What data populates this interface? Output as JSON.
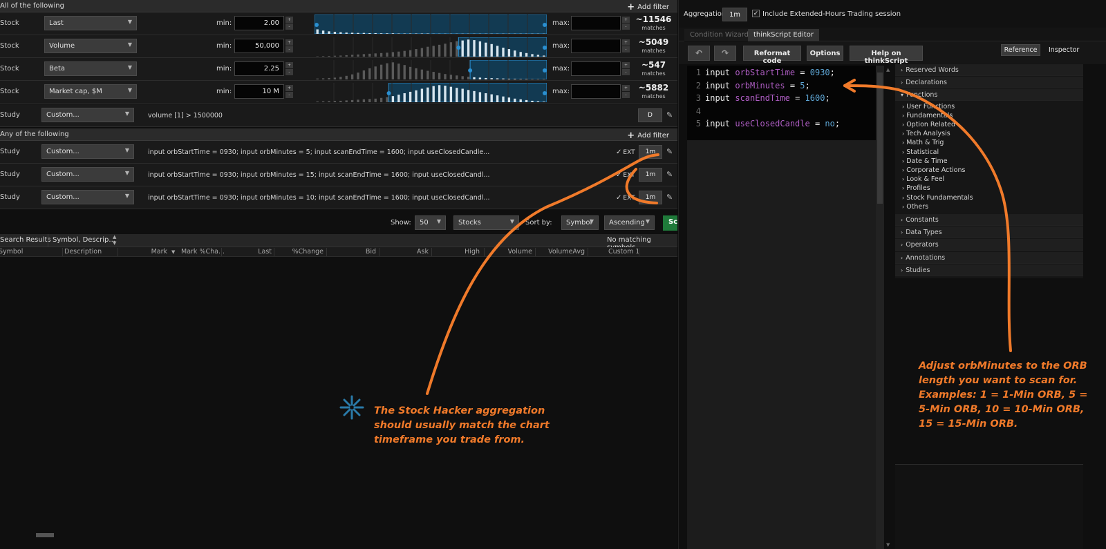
{
  "left": {
    "all_group": {
      "title": "All of the following",
      "add_filter": "Add filter"
    },
    "any_group": {
      "title": "Any of the following",
      "add_filter": "Add filter"
    },
    "filters": [
      {
        "kind": "Stock",
        "field": "Last",
        "min_label": "min:",
        "min": "2.00",
        "max_label": "max:",
        "max": "",
        "count": "~11546",
        "matches": "matches",
        "hist": [
          0.25,
          0.18,
          0.14,
          0.11,
          0.09,
          0.07,
          0.06,
          0.05,
          0.05,
          0.04,
          0.04,
          0.03,
          0.03,
          0.03,
          0.02,
          0.02,
          0.02,
          0.02,
          0.02,
          0.02,
          0.01,
          0.01,
          0.01,
          0.01,
          0.01,
          0.01,
          0.01,
          0.01,
          0.01,
          0.01,
          0.01,
          0.01,
          0.01,
          0.01,
          0.01,
          0.01,
          0.01,
          0.01,
          0.01,
          0.01
        ],
        "range": [
          0.0,
          1.0
        ]
      },
      {
        "kind": "Stock",
        "field": "Volume",
        "min_label": "min:",
        "min": "50,000",
        "max_label": "max:",
        "max": "",
        "count": "~5049",
        "matches": "matches",
        "hist": [
          0.02,
          0.03,
          0.04,
          0.05,
          0.06,
          0.08,
          0.1,
          0.12,
          0.14,
          0.16,
          0.18,
          0.2,
          0.22,
          0.25,
          0.28,
          0.32,
          0.36,
          0.42,
          0.48,
          0.55,
          0.6,
          0.66,
          0.72,
          0.8,
          0.86,
          0.9,
          0.95,
          0.92,
          0.85,
          0.78,
          0.7,
          0.6,
          0.5,
          0.42,
          0.34,
          0.26,
          0.2,
          0.14,
          0.1,
          0.06
        ],
        "range": [
          0.62,
          1.0
        ]
      },
      {
        "kind": "Stock",
        "field": "Beta",
        "min_label": "min:",
        "min": "2.25",
        "max_label": "max:",
        "max": "",
        "count": "~547",
        "matches": "matches",
        "hist": [
          0.05,
          0.06,
          0.08,
          0.1,
          0.14,
          0.2,
          0.28,
          0.38,
          0.5,
          0.62,
          0.72,
          0.82,
          0.9,
          0.95,
          0.88,
          0.8,
          0.7,
          0.62,
          0.55,
          0.48,
          0.42,
          0.36,
          0.3,
          0.26,
          0.22,
          0.18,
          0.15,
          0.12,
          0.1,
          0.08,
          0.07,
          0.06,
          0.05,
          0.04,
          0.04,
          0.03,
          0.03,
          0.02,
          0.02,
          0.02
        ],
        "range": [
          0.67,
          1.0
        ]
      },
      {
        "kind": "Stock",
        "field": "Market cap, $M",
        "min_label": "min:",
        "min": "10 M",
        "max_label": "max:",
        "max": "",
        "count": "~5882",
        "matches": "matches",
        "hist": [
          0.04,
          0.05,
          0.06,
          0.07,
          0.08,
          0.1,
          0.12,
          0.14,
          0.16,
          0.18,
          0.2,
          0.24,
          0.28,
          0.34,
          0.42,
          0.5,
          0.58,
          0.66,
          0.75,
          0.82,
          0.9,
          0.95,
          0.92,
          0.86,
          0.8,
          0.75,
          0.68,
          0.62,
          0.56,
          0.5,
          0.44,
          0.38,
          0.32,
          0.26,
          0.2,
          0.16,
          0.12,
          0.08,
          0.05,
          0.03
        ],
        "range": [
          0.32,
          1.0
        ]
      }
    ],
    "study_all": {
      "kind": "Study",
      "field": "Custom...",
      "condition": "volume [1] > 1500000",
      "agg": "D"
    },
    "study_any": [
      {
        "kind": "Study",
        "field": "Custom...",
        "condition": "input orbStartTime = 0930; input orbMinutes = 5; input scanEndTime = 1600;  input useClosedCandle...",
        "ext": "EXT",
        "agg": "1m"
      },
      {
        "kind": "Study",
        "field": "Custom...",
        "condition": "input orbStartTime = 0930; input orbMinutes = 15; input scanEndTime = 1600;  input useClosedCandl...",
        "ext": "EXT",
        "agg": "1m"
      },
      {
        "kind": "Study",
        "field": "Custom...",
        "condition": "input orbStartTime = 0930; input orbMinutes = 10; input scanEndTime = 1600;  input useClosedCandl...",
        "ext": "EXT",
        "agg": "1m"
      }
    ],
    "show_bar": {
      "show_label": "Show:",
      "show_value": "50",
      "list": "Stocks",
      "sort_label": "Sort by:",
      "sort_by": "Symbol",
      "order": "Ascending",
      "scan_button": "Sc"
    },
    "results": {
      "tab": "Search Results",
      "symbol_desc": "Symbol, Descrip...",
      "status": "No matching symbols"
    },
    "columns": [
      "Symbol",
      "Description",
      "Mark",
      "Mark %Cha...",
      "Last",
      "%Change",
      "Bid",
      "Ask",
      "High",
      "Volume",
      "VolumeAvg",
      "Custom 1"
    ]
  },
  "right": {
    "aggregation_label": "Aggregation:",
    "aggregation_value": "1m",
    "ext_hours_label": "Include Extended-Hours Trading session",
    "tabs": [
      "Condition Wizard",
      "thinkScript Editor"
    ],
    "toolbar": {
      "reformat": "Reformat code",
      "options": "Options",
      "help": "Help on thinkScript",
      "reference": "Reference",
      "inspector": "Inspector"
    },
    "code": [
      {
        "n": "1",
        "kw": "input",
        "var": "orbStartTime",
        "eq": " = ",
        "val": "0930",
        "end": ";"
      },
      {
        "n": "2",
        "kw": "input",
        "var": "orbMinutes",
        "eq": " = ",
        "val": "5",
        "end": ";"
      },
      {
        "n": "3",
        "kw": "input",
        "var": "scanEndTime",
        "eq": " = ",
        "val": "1600",
        "end": ";"
      },
      {
        "n": "4",
        "kw": "",
        "var": "",
        "eq": "",
        "val": "",
        "end": ""
      },
      {
        "n": "5",
        "kw": "input",
        "var": "useClosedCandle",
        "eq": " = ",
        "val": "no",
        "end": ";"
      }
    ],
    "inspector_sections": [
      "Reserved Words",
      "Declarations",
      "Functions"
    ],
    "functions": [
      "User Functions",
      "Fundamentals",
      "Option Related",
      "Tech Analysis",
      "Math & Trig",
      "Statistical",
      "Date & Time",
      "Corporate Actions",
      "Look & Feel",
      "Profiles",
      "Stock Fundamentals",
      "Others"
    ],
    "inspector_sections_2": [
      "Constants",
      "Data Types",
      "Operators",
      "Annotations",
      "Studies"
    ]
  },
  "annotations": {
    "left_note": "The Stock Hacker aggregation should usually match the chart timeframe you trade from.",
    "right_note": "Adjust orbMinutes to the ORB length you want to scan for. Examples: 1 = 1-Min ORB, 5 = 5-Min ORB, 10 = 10-Min ORB, 15 = 15-Min ORB.",
    "color": "#f07a2a"
  },
  "colors": {
    "accent_blue": "#2a8fd0",
    "scan_green": "#1f7a3a"
  }
}
